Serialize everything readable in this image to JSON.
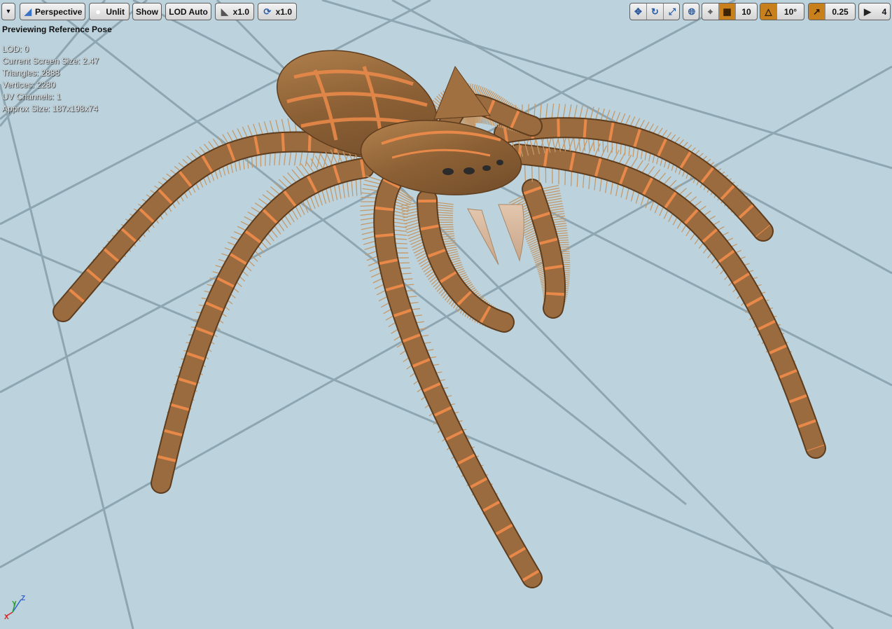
{
  "toolbar": {
    "view_mode": "Perspective",
    "lighting_mode": "Unlit",
    "show_label": "Show",
    "lod_label": "LOD Auto",
    "playback_speed": "x1.0",
    "turntable_speed": "x1.0",
    "grid_snap_value": "10",
    "rotation_snap_value": "10°",
    "scale_snap_value": "0.25",
    "camera_speed_value": "4"
  },
  "overlay": {
    "title": "Previewing Reference Pose",
    "stats": [
      "LOD: 0",
      "Current Screen Size: 2.47",
      "Triangles: 2888",
      "Vertices: 2280",
      "UV Channels: 1",
      "Approx Size: 187x198x74"
    ]
  },
  "axes": {
    "x": "X",
    "y": "Y",
    "z": "Z"
  },
  "colors": {
    "floor": "#b9d0da",
    "floor_line": "#8ea6b2",
    "spider_body": "#a07040",
    "spider_stripe": "#e8894a",
    "spike": "#c4996a",
    "fang": "#d8b8a0",
    "accent_orange": "#c8801c"
  },
  "icons": {
    "menu": "chevron-down-icon",
    "view": "camera-icon",
    "lighting": "sphere-icon",
    "playback": "play-speed-icon",
    "turntable": "rotate-icon",
    "translate": "move-icon",
    "rotate": "rotate-icon",
    "scale": "scale-icon",
    "world": "globe-icon",
    "surface": "surface-snap-icon",
    "grid": "grid-icon",
    "angle": "angle-icon",
    "scale_snap": "scale-snap-icon",
    "camera_speed": "camera-speed-icon"
  }
}
